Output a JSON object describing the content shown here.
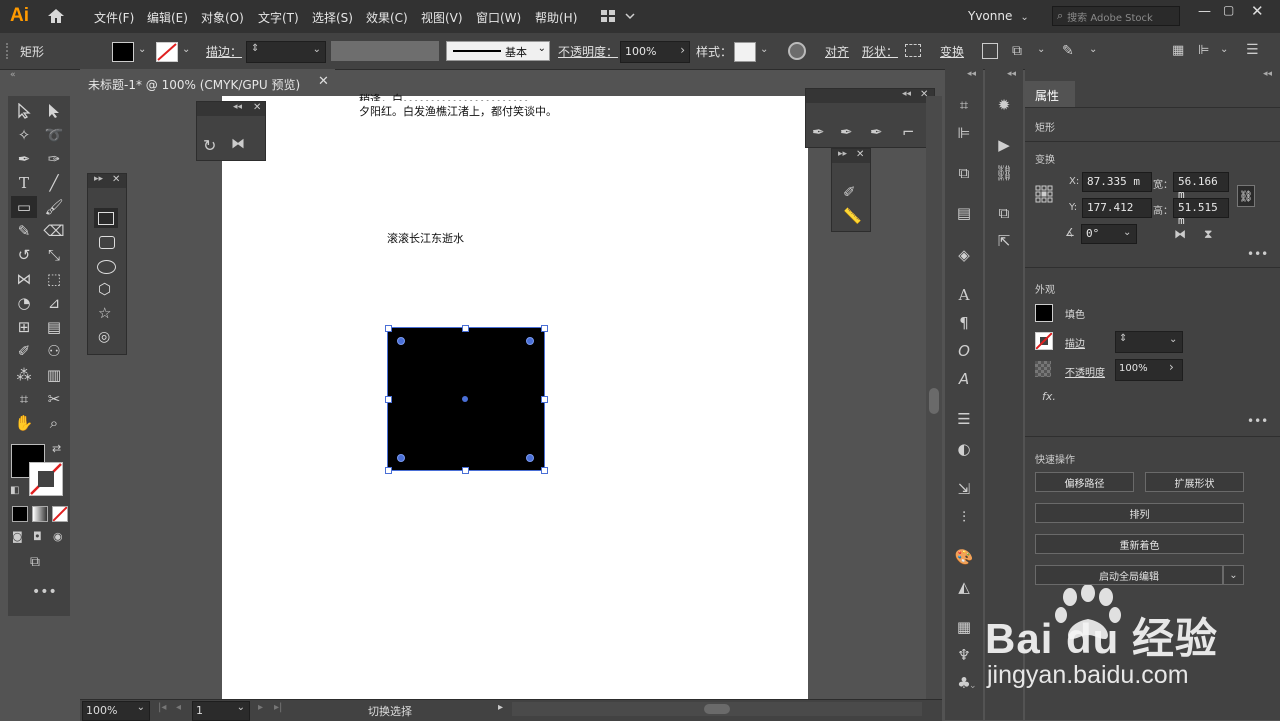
{
  "app": {
    "logo": "Ai",
    "user": "Yvonne",
    "search_placeholder": "搜索 Adobe Stock"
  },
  "menu": [
    "文件(F)",
    "编辑(E)",
    "对象(O)",
    "文字(T)",
    "选择(S)",
    "效果(C)",
    "视图(V)",
    "窗口(W)",
    "帮助(H)"
  ],
  "control": {
    "object_type": "矩形",
    "stroke_label": "描边：",
    "stroke_style": "基本",
    "opacity_label": "不透明度：",
    "opacity_value": "100%",
    "style_label": "样式：",
    "align_label": "对齐",
    "shape_label": "形状：",
    "transform_label": "变换"
  },
  "document": {
    "tab_title": "未标题-1* @ 100% (CMYK/GPU 预览)"
  },
  "canvas": {
    "text_top_1": "稍逢，白。。。。。。。。。。。。。。。。。。。。。。。",
    "text_top_2": "夕阳红。白发渔樵江渚上，都付笑谈中。",
    "text_mid": "滚滚长江东逝水",
    "rect_fill": "#000000",
    "selection_color": "#4a6fd6"
  },
  "properties": {
    "tab": "属性",
    "section_type": "矩形",
    "transform_title": "变换",
    "x_label": "X:",
    "x_value": "87.335 m",
    "y_label": "Y:",
    "y_value": "177.412",
    "w_label": "宽：",
    "w_value": "56.166 m",
    "h_label": "高：",
    "h_value": "51.515 m",
    "angle_value": "0°",
    "appearance_title": "外观",
    "fill_label": "填色",
    "stroke_label": "描边",
    "opacity_label": "不透明度",
    "opacity_value": "100%",
    "fx_label": "fx.",
    "quick_title": "快速操作",
    "btn_offset": "偏移路径",
    "btn_expand": "扩展形状",
    "btn_arrange": "排列",
    "btn_recolor": "重新着色",
    "btn_global": "启动全局编辑"
  },
  "status": {
    "zoom": "100%",
    "page": "1",
    "mode": "切换选择"
  },
  "watermark": {
    "brand": "Bai du 经验",
    "url": "jingyan.baidu.com"
  },
  "colors": {
    "accent": "#ff9a00",
    "panel": "#424242",
    "bg": "#535353"
  }
}
